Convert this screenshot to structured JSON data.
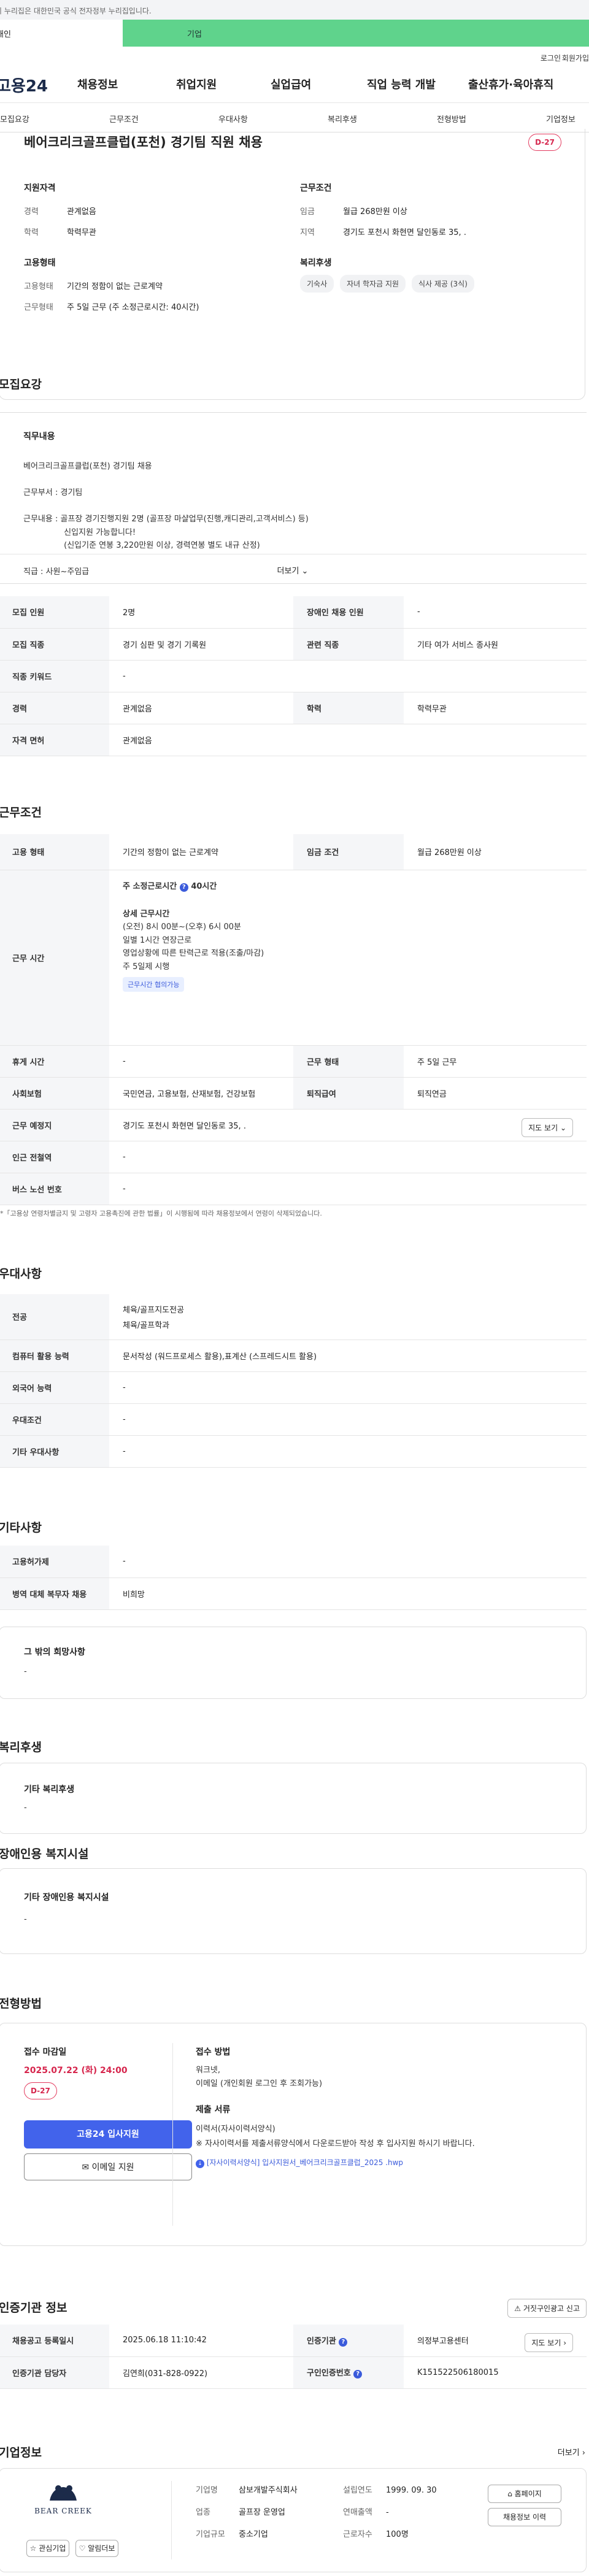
{
  "gov_banner": "이 누리집은 대한민국 공식 전자정부 누리집입니다.",
  "tabs": {
    "personal": "개인",
    "company": "기업"
  },
  "util": {
    "login": "로그인",
    "join": "회원가입"
  },
  "logo": "고용24",
  "menu": [
    "채용정보",
    "취업지원",
    "실업급여",
    "직업 능력 개발",
    "출산휴가·육아휴직"
  ],
  "anchors": [
    "모집요강",
    "근무조건",
    "우대사항",
    "복리후생",
    "전형방법",
    "기업정보"
  ],
  "job": {
    "title": "베어크리크골프클럽(포천) 경기팀 직원 채용",
    "dday": "D-27",
    "qual_title": "지원자격",
    "career_k": "경력",
    "career_v": "관계없음",
    "edu_k": "학력",
    "edu_v": "학력무관",
    "cond_title": "근무조건",
    "wage_k": "임금",
    "wage_v": "월급 268만원 이상",
    "region_k": "지역",
    "region_v": "경기도 포천시 화현면 달인동로 35, .",
    "emp_title": "고용형태",
    "emptype_k": "고용형태",
    "emptype_v": "기간의 정함이 없는 근로계약",
    "workhrs_k": "근무형태",
    "workhrs_v": "주 5일 근무 (주 소정근로시간: 40시간)",
    "welfare_title": "복리후생",
    "welfare_chips": [
      "기숙사",
      "자녀 학자금 지원",
      "식사 제공 (3식)"
    ]
  },
  "recruit": {
    "heading": "모집요강",
    "desc_title": "직무내용",
    "desc_lines": [
      "베어크리크골프클럽(포천) 경기팀 채용",
      "",
      "근무부서 : 경기팀",
      "",
      "근무내용 : 골프장 경기진행지원 2명 (골프장 마샬업무(진행,캐디관리,고객서비스) 등)",
      "                신입지원 가능합니다!",
      "                (신입기준 연봉 3,220만원 이상, 경력연봉 별도 내규 산정)",
      "",
      "직급 : 사원~주임급"
    ],
    "more": "더보기",
    "rows": [
      {
        "k1": "모집 인원",
        "v1": "2명",
        "k2": "장애인 채용 인원",
        "v2": "-"
      },
      {
        "k1": "모집 직종",
        "v1": "경기 심판 및 경기 기록원",
        "k2": "관련 직종",
        "v2": "기타 여가 서비스 종사원"
      },
      {
        "k1": "직종 키워드",
        "v1": "-"
      },
      {
        "k1": "경력",
        "v1": "관계없음",
        "k2": "학력",
        "v2": "학력무관"
      },
      {
        "k1": "자격 면허",
        "v1": "관계없음"
      }
    ]
  },
  "work": {
    "heading": "근무조건",
    "emp_k": "고용 형태",
    "emp_v": "기간의 정함이 없는 근로계약",
    "wage_k": "임금 조건",
    "wage_v": "월급 268만원 이상",
    "time_k": "근무 시간",
    "time_lines": [
      "주 소정근로시간",
      "40시간"
    ],
    "detail_title": "상세 근무시간",
    "detail_lines": [
      "(오전) 8시 00분~(오후) 6시 00분",
      "일별 1시간 연장근로",
      "영업상황에 따른 탄력근로 적용(조출/마감)",
      "주 5일제 시행"
    ],
    "time_badge": "근무시간 협의가능",
    "rest_k": "휴게 시간",
    "rest_v": "-",
    "form_k": "근무 형태",
    "form_v": "주 5일 근무",
    "ins_k": "사회보험",
    "ins_v": "국민연금, 고용보험, 산재보험, 건강보험",
    "ret_k": "퇴직급여",
    "ret_v": "퇴직연금",
    "loc_k": "근무 예정지",
    "loc_v": "경기도 포천시 화현면 달인동로 35, .",
    "map_btn": "지도 보기",
    "sub_k": "인근 전철역",
    "sub_v": "-",
    "bus_k": "버스 노선 번호",
    "bus_v": "-",
    "note": "*「고용상 연령차별금지 및 고령자 고용촉진에 관한 법률」이 시행됨에 따라 채용정보에서 연령이 삭제되었습니다."
  },
  "pref": {
    "heading": "우대사항",
    "rows": [
      {
        "k": "전공",
        "v": [
          "체육/골프지도전공",
          "체육/골프학과"
        ]
      },
      {
        "k": "컴퓨터 활용 능력",
        "v": [
          "문서작성 (워드프로세스 활용),표계산 (스프레드시트 활용)"
        ]
      },
      {
        "k": "외국어 능력",
        "v": [
          "-"
        ]
      },
      {
        "k": "우대조건",
        "v": [
          "-"
        ]
      },
      {
        "k": "기타 우대사항",
        "v": [
          "-"
        ]
      }
    ]
  },
  "etc": {
    "heading": "기타사항",
    "rows": [
      {
        "k": "고용허가제",
        "v": "-"
      },
      {
        "k": "병역 대체 복무자 채용",
        "v": "비희망"
      }
    ],
    "box_title": "그 밖의 희망사항",
    "box_v": "-"
  },
  "welfare": {
    "heading": "복리후생",
    "box_title": "기타 복리후생",
    "box_v": "-"
  },
  "disabled": {
    "heading": "장애인용 복지시설",
    "box_title": "기타 장애인용 복지시설",
    "box_v": "-"
  },
  "process": {
    "heading": "전형방법",
    "deadline_title": "접수 마감일",
    "deadline": "2025.07.22 (화) 24:00",
    "dday": "D-27",
    "apply_btn": "고용24 입사지원",
    "email_btn": "이메일 지원",
    "method_title": "접수 방법",
    "method_lines": [
      "워크넷,",
      "이메일 (개인회원 로그인 후 조회가능)"
    ],
    "docs_title": "제출 서류",
    "docs_lines": [
      "이력서(자사이력서양식)",
      "※ 자사이력서를 제출서류양식에서 다운로드받아 작성 후 입사지원 하시기 바랍니다."
    ],
    "file": "[자사이력서양식] 입사지원서_베어크리크골프클럽_2025 .hwp"
  },
  "agency": {
    "heading": "인증기관 정보",
    "report_btn": "거짓구인광고 신고",
    "reg_k": "채용공고 등록일시",
    "reg_v": "2025.06.18 11:10:42",
    "org_k": "인증기관",
    "org_v": "의정부고용센터",
    "map_btn": "지도 보기",
    "mgr_k": "인증기관 담당자",
    "mgr_v": "김연희(031-828-0922)",
    "no_k": "구인인증번호",
    "no_v": "K151522506180015"
  },
  "company": {
    "heading": "기업정보",
    "more": "더보기",
    "logo_text": "BEAR CREEK",
    "fields": [
      {
        "k": "기업명",
        "v": "삼보개발주식회사"
      },
      {
        "k": "업종",
        "v": "골프장 운영업"
      },
      {
        "k": "기업규모",
        "v": "중소기업"
      }
    ],
    "fields2": [
      {
        "k": "설립연도",
        "v": "1999. 09. 30"
      },
      {
        "k": "연매출액",
        "v": "-"
      },
      {
        "k": "근로자수",
        "v": "100명"
      }
    ],
    "homepage_btn": "홈페이지",
    "history_btn": "채용정보 이력",
    "interest_btn": "관심기업",
    "alarm_btn": "알림더보"
  }
}
